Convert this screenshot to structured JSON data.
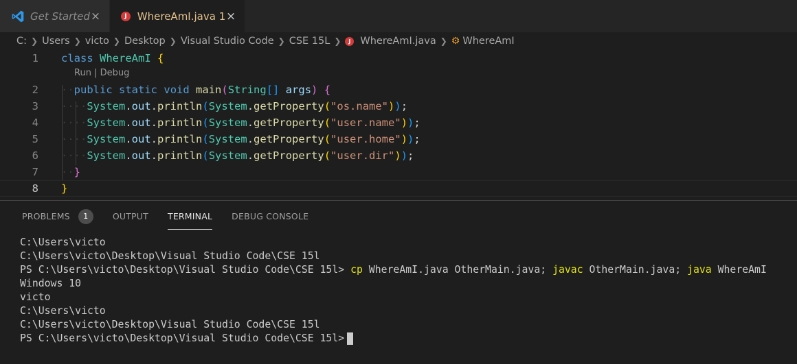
{
  "tabs": [
    {
      "label": "Get Started",
      "close": "×"
    },
    {
      "label": "WhereAmI.java 1",
      "close": "×",
      "icon_letter": "J"
    }
  ],
  "breadcrumb": [
    "C:",
    "Users",
    "victo",
    "Desktop",
    "Visual Studio Code",
    "CSE 15L",
    "WhereAmI.java",
    "WhereAmI"
  ],
  "editor": {
    "codelens": "Run | Debug",
    "line_numbers": [
      "1",
      "2",
      "3",
      "4",
      "5",
      "6",
      "7",
      "8"
    ],
    "tokens": {
      "class_kw": "class",
      "class_name": "WhereAmI",
      "public_kw": "public",
      "static_kw": "static",
      "void_kw": "void",
      "main_fn": "main",
      "string_type": "String",
      "args_var": "args",
      "system": "System",
      "out": "out",
      "println": "println",
      "getProperty": "getProperty",
      "str_os": "\"os.name\"",
      "str_user": "\"user.name\"",
      "str_home": "\"user.home\"",
      "str_dir": "\"user.dir\""
    }
  },
  "panel": {
    "tabs": [
      "PROBLEMS",
      "OUTPUT",
      "TERMINAL",
      "DEBUG CONSOLE"
    ],
    "problems_count": "1",
    "terminal": {
      "line1": "C:\\Users\\victo",
      "line2": "C:\\Users\\victo\\Desktop\\Visual Studio Code\\CSE 15l",
      "prompt": "PS C:\\Users\\victo\\Desktop\\Visual Studio Code\\CSE 15l> ",
      "cmd_cp": "cp",
      "cmd_cp_args": " WhereAmI.java OtherMain.java; ",
      "cmd_javac": "javac",
      "cmd_javac_args": " OtherMain.java; ",
      "cmd_java": "java",
      "cmd_java_args": " WhereAmI",
      "out1": "Windows 10",
      "out2": "victo",
      "out3": "C:\\Users\\victo",
      "out4": "C:\\Users\\victo\\Desktop\\Visual Studio Code\\CSE 15l",
      "final_prompt": "PS C:\\Users\\victo\\Desktop\\Visual Studio Code\\CSE 15l>"
    }
  },
  "colors": {
    "accent_tab_text": "#e2c08d",
    "java_icon": "#d63b3b",
    "terminal_command": "#e5e510"
  }
}
